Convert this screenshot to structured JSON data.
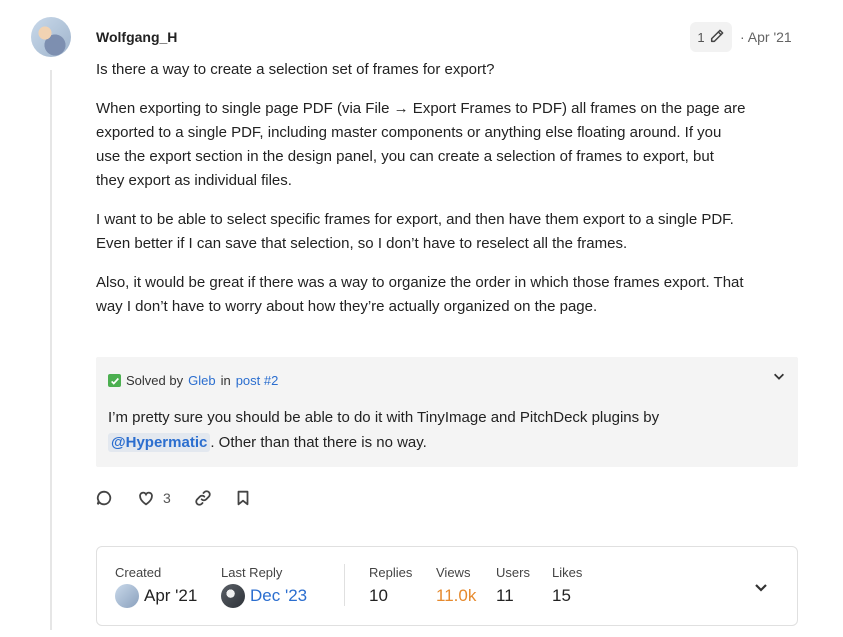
{
  "post": {
    "username": "Wolfgang_H",
    "edit_count": "1",
    "date": "Apr '21",
    "paragraphs": [
      "Is there a way to create a selection set of frames for export?",
      "When exporting to single page PDF (via File → Export Frames to PDF) all frames on the page are exported to a single PDF, including master components or anything else floating around. If you use the export section in the design panel, you can create a selection of frames to export, but they export as individual files.",
      "I want to be able to select specific frames for export, and then have them export to a single PDF. Even better if I can save that selection, so I don’t have to reselect all the frames.",
      "Also, it would be great if there was a way to organize the order in which those frames export. That way I don’t have to worry about how they’re actually organized on the page."
    ]
  },
  "solution": {
    "solved_by": "Solved by",
    "author": "Gleb",
    "in": "in",
    "post_link": "post #2",
    "text_before": "I’m pretty sure you should be able to do it with TinyImage and PitchDeck plugins by",
    "mention": "@Hypermatic",
    "text_after": ". Other than that there is no way."
  },
  "actions": {
    "like_count": "3"
  },
  "topic_map": {
    "created_label": "Created",
    "created_value": "Apr '21",
    "last_reply_label": "Last Reply",
    "last_reply_value": "Dec '23",
    "replies_label": "Replies",
    "replies_value": "10",
    "views_label": "Views",
    "views_value": "11.0k",
    "users_label": "Users",
    "users_value": "11",
    "likes_label": "Likes",
    "likes_value": "15"
  },
  "colors": {
    "link": "#2b6ecf",
    "views": "#e68a2e",
    "solved_check": "#4caf50"
  }
}
